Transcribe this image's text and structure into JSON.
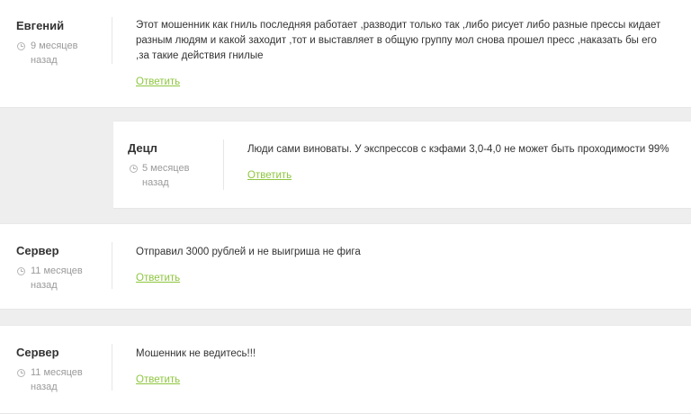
{
  "comments": [
    {
      "author": "Евгений",
      "time_line1": "9 месяцев",
      "time_line2": "назад",
      "text": "Этот мошенник как гниль последняя работает ,разводит только так ,либо рисует либо разные прессы кидает разным людям и какой заходит ,тот и выставляет в общую группу мол снова прошел пресс ,наказать бы его ,за такие действия гнилые",
      "reply_label": "Ответить"
    },
    {
      "author": "Децл",
      "time_line1": "5 месяцев",
      "time_line2": "назад",
      "text": "Люди сами виноваты. У экспрессов с кэфами 3,0-4,0 не может быть проходимости 99%",
      "reply_label": "Ответить"
    },
    {
      "author": "Сервер",
      "time_line1": "11 месяцев",
      "time_line2": "назад",
      "text": "Отправил 3000 рублей и не выигриша не фига",
      "reply_label": "Ответить"
    },
    {
      "author": "Сервер",
      "time_line1": "11 месяцев",
      "time_line2": "назад",
      "text": "Мошенник не ведитесь!!!",
      "reply_label": "Ответить"
    }
  ]
}
